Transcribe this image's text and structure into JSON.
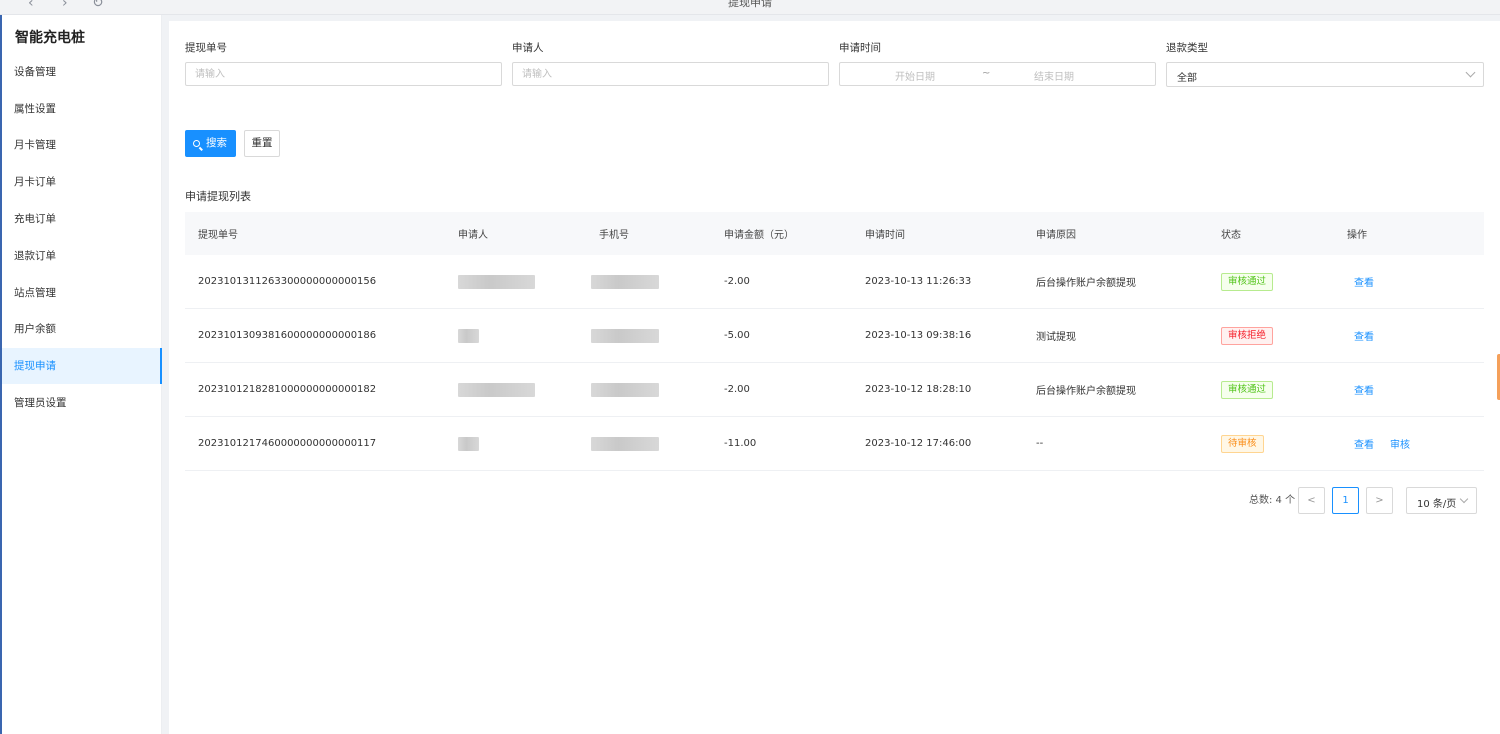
{
  "window": {
    "title": "提现申请"
  },
  "sidebar": {
    "brand": "智能充电桩",
    "items": [
      {
        "label": "设备管理",
        "active": false
      },
      {
        "label": "属性设置",
        "active": false
      },
      {
        "label": "月卡管理",
        "active": false
      },
      {
        "label": "月卡订单",
        "active": false
      },
      {
        "label": "充电订单",
        "active": false
      },
      {
        "label": "退款订单",
        "active": false
      },
      {
        "label": "站点管理",
        "active": false
      },
      {
        "label": "用户余额",
        "active": false
      },
      {
        "label": "提现申请",
        "active": true
      },
      {
        "label": "管理员设置",
        "active": false
      }
    ]
  },
  "filters": {
    "order_no": {
      "label": "提现单号",
      "placeholder": "请输入"
    },
    "applicant": {
      "label": "申请人",
      "placeholder": "请输入"
    },
    "apply_time": {
      "label": "申请时间",
      "start_placeholder": "开始日期",
      "separator": "~",
      "end_placeholder": "结束日期"
    },
    "refund_type": {
      "label": "退款类型",
      "value": "全部"
    }
  },
  "actions": {
    "search_label": "搜索",
    "reset_label": "重置"
  },
  "list": {
    "title": "申请提现列表",
    "columns": [
      "提现单号",
      "申请人",
      "手机号",
      "申请金额（元）",
      "申请时间",
      "申请原因",
      "状态",
      "操作"
    ],
    "rows": [
      {
        "order_no": "2023101311263300000000000156",
        "amount": "-2.00",
        "time": "2023-10-13 11:26:33",
        "reason": "后台操作账户余额提现",
        "status": "审核通过",
        "status_kind": "ok",
        "actions": [
          "查看"
        ]
      },
      {
        "order_no": "2023101309381600000000000186",
        "amount": "-5.00",
        "time": "2023-10-13 09:38:16",
        "reason": "测试提现",
        "status": "审核拒绝",
        "status_kind": "no",
        "actions": [
          "查看"
        ]
      },
      {
        "order_no": "2023101218281000000000000182",
        "amount": "-2.00",
        "time": "2023-10-12 18:28:10",
        "reason": "后台操作账户余额提现",
        "status": "审核通过",
        "status_kind": "ok",
        "actions": [
          "查看"
        ]
      },
      {
        "order_no": "2023101217460000000000000117",
        "amount": "-11.00",
        "time": "2023-10-12 17:46:00",
        "reason": "--",
        "status": "待审核",
        "status_kind": "wait",
        "actions": [
          "查看",
          "审核"
        ]
      }
    ]
  },
  "pagination": {
    "total_text": "总数: 4 个",
    "prev": "<",
    "page": "1",
    "next": ">",
    "page_size": "10 条/页"
  },
  "colors": {
    "primary": "#1890ff",
    "success": "#52c41a",
    "danger": "#f5222d",
    "warning": "#fa8c16"
  }
}
